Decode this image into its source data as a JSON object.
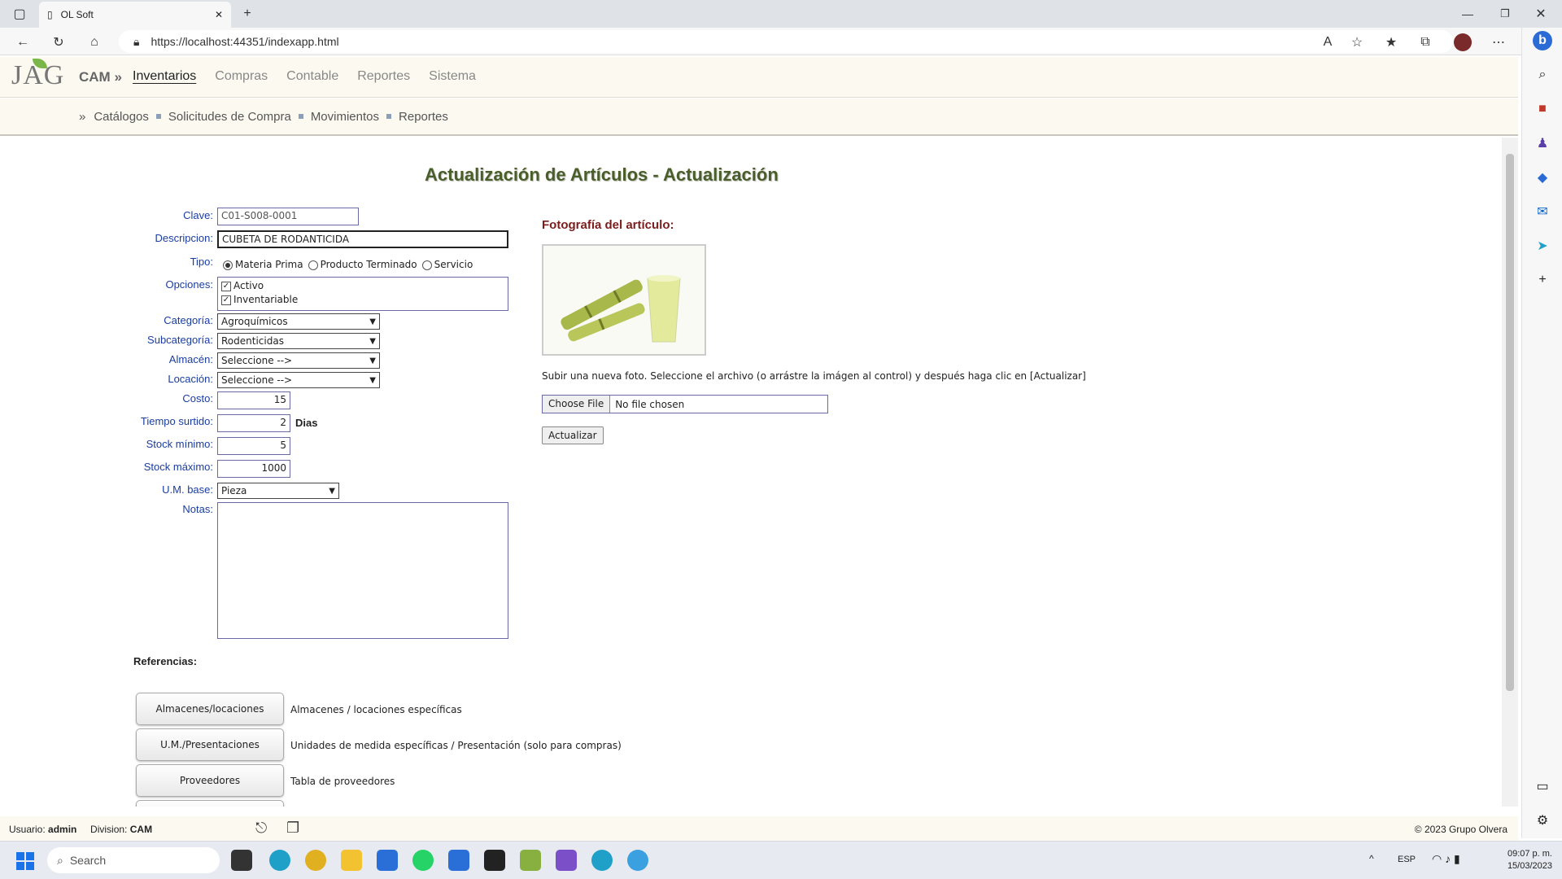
{
  "browser": {
    "tab_title": "OL Soft",
    "url": "https://localhost:44351/indexapp.html"
  },
  "app": {
    "logo_text": "JAG",
    "brand": "CAM »",
    "main_nav": [
      "Inventarios",
      "Compras",
      "Contable",
      "Reportes",
      "Sistema"
    ],
    "sub_nav": [
      "Catálogos",
      "Solicitudes de Compra",
      "Movimientos",
      "Reportes"
    ]
  },
  "form": {
    "title": "Actualización de Artículos - Actualización",
    "clave_label": "Clave:",
    "clave_value": "C01-S008-0001",
    "descripcion_label": "Descripcion:",
    "descripcion_value": "CUBETA DE RODANTICIDA",
    "tipo_label": "Tipo:",
    "tipo_options": [
      "Materia Prima",
      "Producto Terminado",
      "Servicio"
    ],
    "tipo_selected": "Materia Prima",
    "opciones_label": "Opciones:",
    "opcion_activo": "Activo",
    "opcion_inventariable": "Inventariable",
    "categoria_label": "Categoría:",
    "categoria_value": "Agroquímicos",
    "subcategoria_label": "Subcategoría:",
    "subcategoria_value": "Rodenticidas",
    "almacen_label": "Almacén:",
    "almacen_value": "Seleccione -->",
    "locacion_label": "Locación:",
    "locacion_value": "Seleccione -->",
    "costo_label": "Costo:",
    "costo_value": "15",
    "tiempo_label": "Tiempo surtido:",
    "tiempo_value": "2",
    "tiempo_unit": "Dias",
    "stock_min_label": "Stock mínimo:",
    "stock_min_value": "5",
    "stock_max_label": "Stock máximo:",
    "stock_max_value": "1000",
    "um_label": "U.M. base:",
    "um_value": "Pieza",
    "notas_label": "Notas:"
  },
  "photo": {
    "title": "Fotografía del artículo:",
    "upload_text": "Subir una nueva foto. Seleccione el archivo (o arrástre la imágen al control) y después haga clic en [Actualizar]",
    "choose_file": "Choose File",
    "no_file": "No file chosen",
    "update_button": "Actualizar"
  },
  "references": {
    "title": "Referencias:",
    "items": [
      {
        "button": "Almacenes/locaciones",
        "desc": "Almacenes / locaciones específicas"
      },
      {
        "button": "U.M./Presentaciones",
        "desc": "Unidades de medida específicas / Presentación (solo para compras)"
      },
      {
        "button": "Proveedores",
        "desc": "Tabla de proveedores"
      }
    ]
  },
  "footer": {
    "user_label": "Usuario:",
    "user": "admin",
    "division_label": "Division:",
    "division": "CAM",
    "copyright": "© 2023 Grupo Olvera"
  },
  "taskbar": {
    "search": "Search",
    "lang": "ESP",
    "time": "09:07 p. m.",
    "date": "15/03/2023"
  },
  "colors": {
    "title_green": "#4a5e2a",
    "label_blue": "#1a3da0",
    "photo_title_red": "#7a1d1d",
    "header_bg": "#fcf9f1"
  }
}
